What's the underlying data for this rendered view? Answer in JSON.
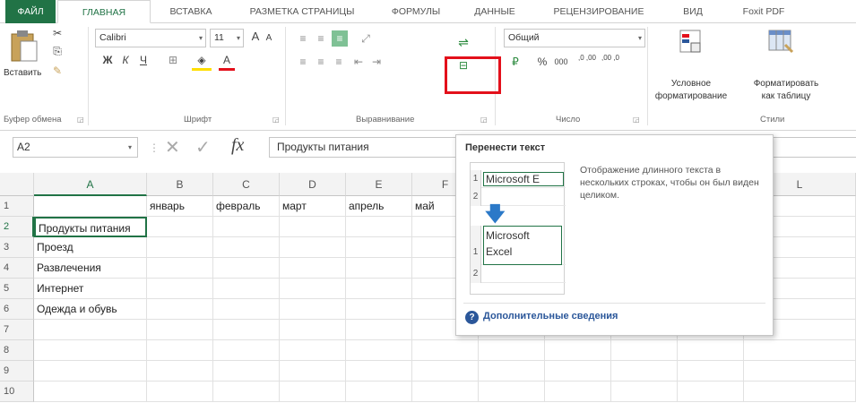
{
  "tabs": [
    "ФАЙЛ",
    "ГЛАВНАЯ",
    "ВСТАВКА",
    "РАЗМЕТКА СТРАНИЦЫ",
    "ФОРМУЛЫ",
    "ДАННЫЕ",
    "РЕЦЕНЗИРОВАНИЕ",
    "ВИД",
    "Foxit PDF"
  ],
  "ribbon": {
    "paste_label": "Вставить",
    "font_name": "Calibri",
    "font_size": "11",
    "number_format": "Общий",
    "cond_format_label1": "Условное",
    "cond_format_label2": "форматирование",
    "format_table_label1": "Форматировать",
    "format_table_label2": "как таблицу",
    "groups": {
      "clipboard": "Буфер обмена",
      "font": "Шрифт",
      "alignment": "Выравнивание",
      "number": "Число",
      "styles": "Стили"
    },
    "bold": "Ж",
    "italic": "К",
    "underline": "Ч",
    "font_grow": "A",
    "font_shrink": "A",
    "font_color": "A",
    "percent": "%",
    "thousands": "000",
    "dec_inc": ",0 ,00",
    "dec_dec": ",00 ,0"
  },
  "formula_bar": {
    "name_box": "A2",
    "fx": "fx",
    "formula": "Продукты питания"
  },
  "columns": [
    "A",
    "B",
    "C",
    "D",
    "E",
    "F",
    "",
    "",
    "",
    "",
    "L"
  ],
  "rows": [
    "1",
    "2",
    "3",
    "4",
    "5",
    "6",
    "7",
    "8",
    "9",
    "10"
  ],
  "row1_headers": [
    "январь",
    "февраль",
    "март",
    "апрель",
    "май"
  ],
  "col_a": [
    "",
    "Продукты питания",
    "Проезд",
    "Развлечения",
    "Интернет",
    "Одежда и обувь",
    "",
    "",
    "",
    ""
  ],
  "tooltip": {
    "title": "Перенести текст",
    "description": "Отображение длинного текста в нескольких строках, чтобы он был виден целиком.",
    "more": "Дополнительные сведения",
    "help_icon": "?",
    "demo_before": "Microsoft E",
    "demo_after_1": "Microsoft",
    "demo_after_2": "Excel",
    "demo_rows_top": [
      "1",
      "2"
    ],
    "demo_rows_bottom": [
      "1",
      "2"
    ]
  },
  "colors": {
    "accent": "#217346",
    "highlight": "#e3101b",
    "link": "#2b579a"
  }
}
